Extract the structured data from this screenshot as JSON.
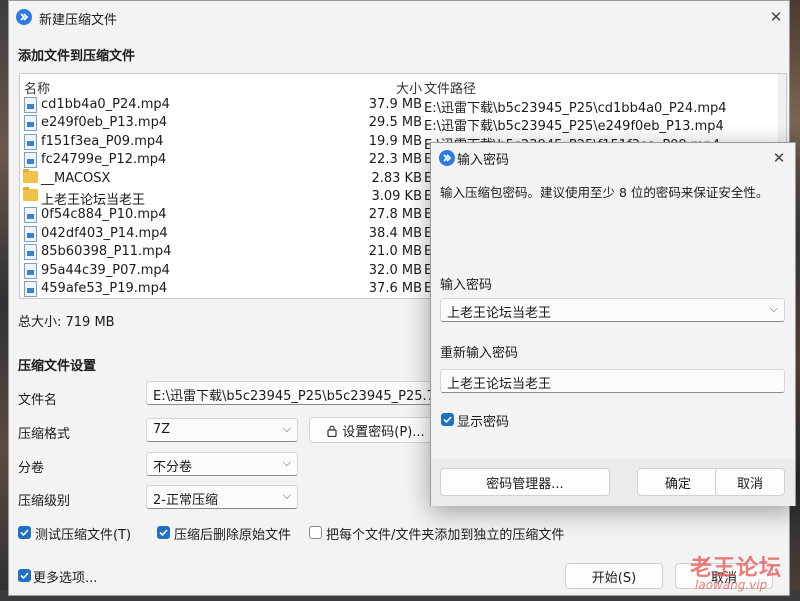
{
  "main": {
    "title": "新建压缩文件",
    "add_section": "添加文件到压缩文件",
    "columns": {
      "name": "名称",
      "size": "大小",
      "path": "文件路径"
    },
    "files": [
      {
        "name": "cd1bb4a0_P24.mp4",
        "size": "37.9 MB",
        "path": "E:\\迅雷下载\\b5c23945_P25\\cd1bb4a0_P24.mp4",
        "type": "file"
      },
      {
        "name": "e249f0eb_P13.mp4",
        "size": "29.5 MB",
        "path": "E:\\迅雷下载\\b5c23945_P25\\e249f0eb_P13.mp4",
        "type": "file"
      },
      {
        "name": "f151f3ea_P09.mp4",
        "size": "19.9 MB",
        "path": "E:\\迅雷下载\\b5c23945_P25\\f151f3ea_P09.mp4",
        "type": "file"
      },
      {
        "name": "fc24799e_P12.mp4",
        "size": "22.3 MB",
        "path": "E:",
        "type": "file"
      },
      {
        "name": "__MACOSX",
        "size": "2.83 KB",
        "path": "E:",
        "type": "folder"
      },
      {
        "name": "上老王论坛当老王",
        "size": "3.09 KB",
        "path": "E:",
        "type": "folder"
      },
      {
        "name": "0f54c884_P10.mp4",
        "size": "27.8 MB",
        "path": "E:",
        "type": "file"
      },
      {
        "name": "042df403_P14.mp4",
        "size": "38.4 MB",
        "path": "E:",
        "type": "file"
      },
      {
        "name": "85b60398_P11.mp4",
        "size": "21.0 MB",
        "path": "E:",
        "type": "file"
      },
      {
        "name": "95a44c39_P07.mp4",
        "size": "32.0 MB",
        "path": "E:",
        "type": "file"
      },
      {
        "name": "459afe53_P19.mp4",
        "size": "37.6 MB",
        "path": "E:",
        "type": "file"
      }
    ],
    "total_size": "总大小: 719 MB",
    "settings_section": "压缩文件设置",
    "filename_label": "文件名",
    "filename_value": "E:\\迅雷下载\\b5c23945_P25\\b5c23945_P25.7删掉z",
    "format_label": "压缩格式",
    "format_value": "7Z",
    "set_password_button": "设置密码(P)...",
    "split_label": "分卷",
    "split_value": "不分卷",
    "level_label": "压缩级别",
    "level_value": "2-正常压缩",
    "test_checkbox": "测试压缩文件(T)",
    "delete_checkbox": "压缩后删除原始文件",
    "separate_checkbox": "把每个文件/文件夹添加到独立的压缩文件",
    "more_options": "更多选项...",
    "start_button": "开始(S)",
    "cancel_button": "取消"
  },
  "password_dialog": {
    "title": "输入密码",
    "description": "输入压缩包密码。建议使用至少 8 位的密码来保证安全性。",
    "password_label": "输入密码",
    "password_value": "上老王论坛当老王",
    "confirm_label": "重新输入密码",
    "confirm_value": "上老王论坛当老王",
    "show_password": "显示密码",
    "manager_button": "密码管理器...",
    "ok_button": "确定",
    "cancel_button": "取消"
  },
  "watermark": {
    "text": "老王论坛",
    "url": "laowang.vip"
  },
  "colors": {
    "accent": "#1f6fc5",
    "app_icon": "#2c7be5",
    "watermark": "#e65050"
  }
}
